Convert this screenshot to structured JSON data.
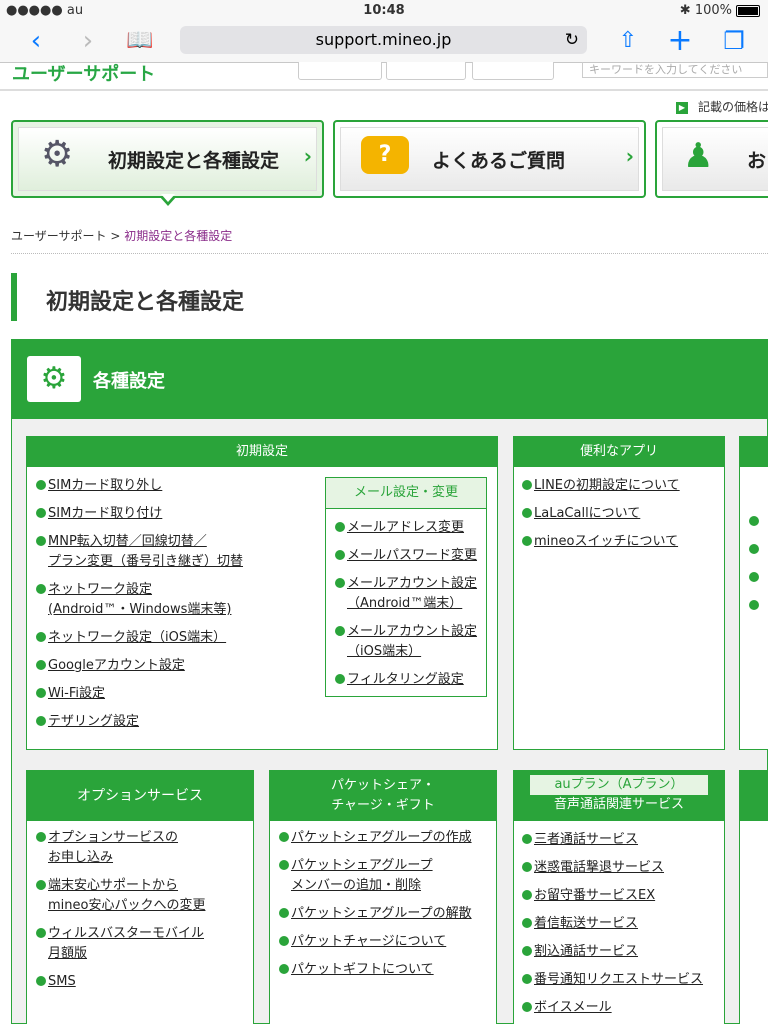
{
  "status": {
    "carrier": "●●●●● au",
    "time": "10:48",
    "battery": "100%"
  },
  "browser": {
    "url": "support.mineo.jp"
  },
  "site": {
    "logo": "ユーザーサポート",
    "search_placeholder": "キーワードを入力してください",
    "price_note": "記載の価格は"
  },
  "nav": [
    {
      "label": "初期設定と各種設定"
    },
    {
      "label": "よくあるご質問"
    },
    {
      "label": "お"
    }
  ],
  "breadcrumb": {
    "home": "ユーザーサポート",
    "sep": ">",
    "current": "初期設定と各種設定"
  },
  "page_title": "初期設定と各種設定",
  "section": {
    "title": "各種設定"
  },
  "box_initial": {
    "title": "初期設定",
    "items": [
      [
        "SIMカード取り外し"
      ],
      [
        "SIMカード取り付け"
      ],
      [
        "MNP転入切替／回線切替／",
        "プラン変更（番号引き継ぎ）切替"
      ],
      [
        "ネットワーク設定",
        "(Android™・Windows端末等)"
      ],
      [
        "ネットワーク設定（iOS端末）"
      ],
      [
        "Googleアカウント設定"
      ],
      [
        "Wi-Fi設定"
      ],
      [
        "テザリング設定"
      ]
    ],
    "mail": {
      "title": "メール設定・変更",
      "items": [
        [
          "メールアドレス変更"
        ],
        [
          "メールパスワード変更"
        ],
        [
          "メールアカウント設定",
          "（Android™端末）"
        ],
        [
          "メールアカウント設定",
          "（iOS端末）"
        ],
        [
          "フィルタリング設定"
        ]
      ]
    }
  },
  "box_apps": {
    "title": "便利なアプリ",
    "items": [
      [
        "LINEの初期設定について"
      ],
      [
        "LaLaCallについて"
      ],
      [
        "mineoスイッチについて"
      ]
    ]
  },
  "box_options": {
    "title": "オプションサービス",
    "items": [
      [
        "オプションサービスの",
        "お申し込み"
      ],
      [
        "端末安心サポートから",
        "mineo安心パックへの変更"
      ],
      [
        "ウィルスバスターモバイル",
        "月額版"
      ],
      [
        "SMS"
      ]
    ]
  },
  "box_packet": {
    "title1": "パケットシェア・",
    "title2": "チャージ・ギフト",
    "items": [
      [
        "パケットシェアグループの作成"
      ],
      [
        "パケットシェアグループ",
        "メンバーの追加・削除"
      ],
      [
        "パケットシェアグループの解散"
      ],
      [
        "パケットチャージについて"
      ],
      [
        "パケットギフトについて"
      ]
    ]
  },
  "box_voice": {
    "subtitle": "auプラン（Aプラン）",
    "title": "音声通話関連サービス",
    "items": [
      [
        "三者通話サービス"
      ],
      [
        "迷惑電話撃退サービス"
      ],
      [
        "お留守番サービスEX"
      ],
      [
        "着信転送サービス"
      ],
      [
        "割込通話サービス"
      ],
      [
        "番号通知リクエストサービス"
      ],
      [
        "ボイスメール"
      ]
    ]
  }
}
